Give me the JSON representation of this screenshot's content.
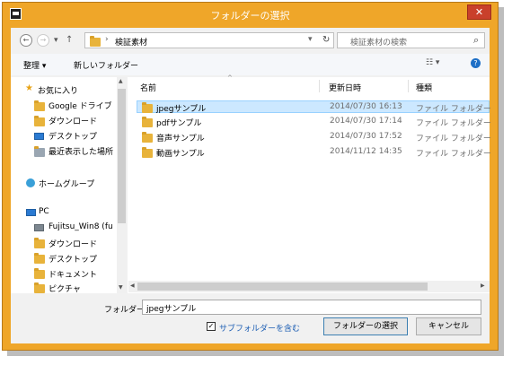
{
  "window": {
    "title": "フォルダーの選択",
    "close_glyph": "✕"
  },
  "nav": {
    "back_glyph": "←",
    "forward_glyph": "→",
    "dropdown_glyph": "▾",
    "up_glyph": "↑",
    "breadcrumb_sep": "›",
    "current_folder": "検証素材",
    "refresh_glyph": "↻",
    "search_placeholder": "検証素材の検索",
    "search_glyph": "⌕"
  },
  "toolbar": {
    "organize_label": "整理 ▾",
    "new_folder_label": "新しいフォルダー",
    "view_glyph": "☷ ▾",
    "help_glyph": "?"
  },
  "sidebar": {
    "items": [
      {
        "label": "お気に入り"
      },
      {
        "label": "Google ドライブ"
      },
      {
        "label": "ダウンロード"
      },
      {
        "label": "デスクトップ"
      },
      {
        "label": "最近表示した場所"
      },
      {
        "label": "ホームグループ"
      },
      {
        "label": "PC"
      },
      {
        "label": "Fujitsu_Win8 (fu"
      },
      {
        "label": "ダウンロード"
      },
      {
        "label": "デスクトップ"
      },
      {
        "label": "ドキュメント"
      },
      {
        "label": "ピクチャ"
      }
    ],
    "scroll_up": "▲",
    "scroll_down": "▼"
  },
  "files": {
    "columns": {
      "name": "名前",
      "date": "更新日時",
      "type": "種類"
    },
    "sort_glyph": "^",
    "rows": [
      {
        "name": "jpegサンプル",
        "date": "2014/07/30 16:13",
        "type": "ファイル フォルダー"
      },
      {
        "name": "pdfサンプル",
        "date": "2014/07/30 17:14",
        "type": "ファイル フォルダー"
      },
      {
        "name": "音声サンプル",
        "date": "2014/07/30 17:52",
        "type": "ファイル フォルダー"
      },
      {
        "name": "動画サンプル",
        "date": "2014/11/12 14:35",
        "type": "ファイル フォルダー"
      }
    ],
    "scroll_left": "◀",
    "scroll_right": "▶"
  },
  "bottom": {
    "folder_label": "フォルダー:",
    "folder_value": "jpegサンプル",
    "subfolder_checkbox_label": "サブフォルダーを含む",
    "check_glyph": "✓",
    "select_button": "フォルダーの選択",
    "cancel_button": "キャンセル"
  },
  "colors": {
    "title_bar": "#efa629",
    "selection": "#cce8ff",
    "close": "#c9402b"
  }
}
